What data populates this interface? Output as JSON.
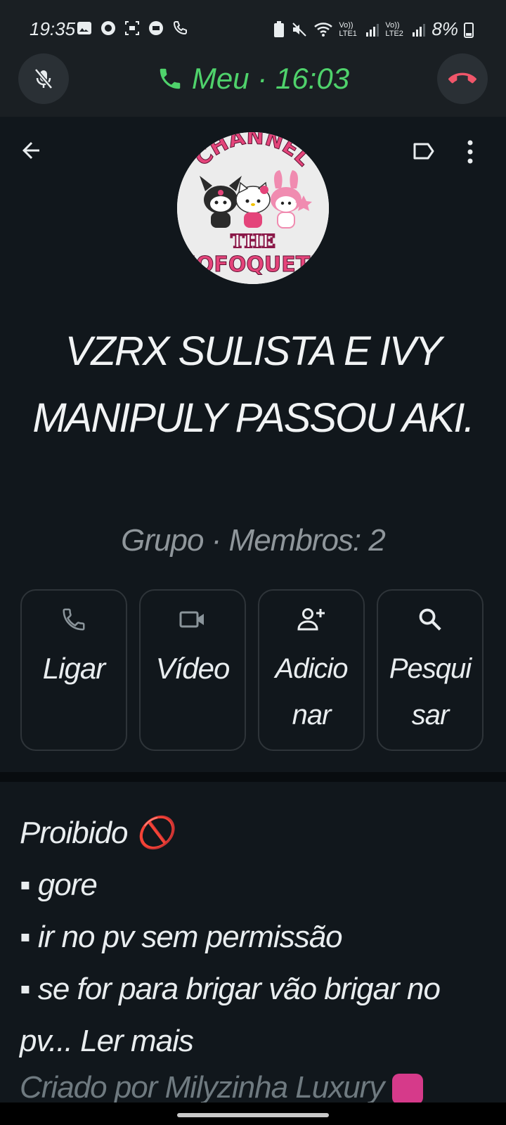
{
  "status_bar": {
    "time": "19:35",
    "battery": "8%",
    "network1": "Vo)) LTE1",
    "network2": "Vo)) LTE2"
  },
  "call_banner": {
    "title": "Meu · 16:03",
    "accent": "#4fd26b",
    "end_color": "#f0566a"
  },
  "group": {
    "avatar_text_top": "CHANNEL",
    "avatar_text_mid": "THE",
    "avatar_text_bottom": "FOFOQUETE",
    "title": "VZRX SULISTA E IVY MANIPULY PASSOU AKI.",
    "subtitle": "Grupo · Membros: 2"
  },
  "actions": [
    {
      "label": "Ligar",
      "icon": "phone-icon"
    },
    {
      "label": "Vídeo",
      "icon": "video-icon"
    },
    {
      "label": "Adicionar",
      "icon": "add-user-icon"
    },
    {
      "label": "Pesquisar",
      "icon": "search-icon"
    }
  ],
  "description": {
    "line1": "Proibido 🚫",
    "line2": "▪ gore",
    "line3": "▪ ir no pv sem permissão",
    "line4": "▪ se for para brigar vão brigar no pv...",
    "read_more": "Ler mais"
  },
  "creator": "Criado por Milyzinha Luxury"
}
